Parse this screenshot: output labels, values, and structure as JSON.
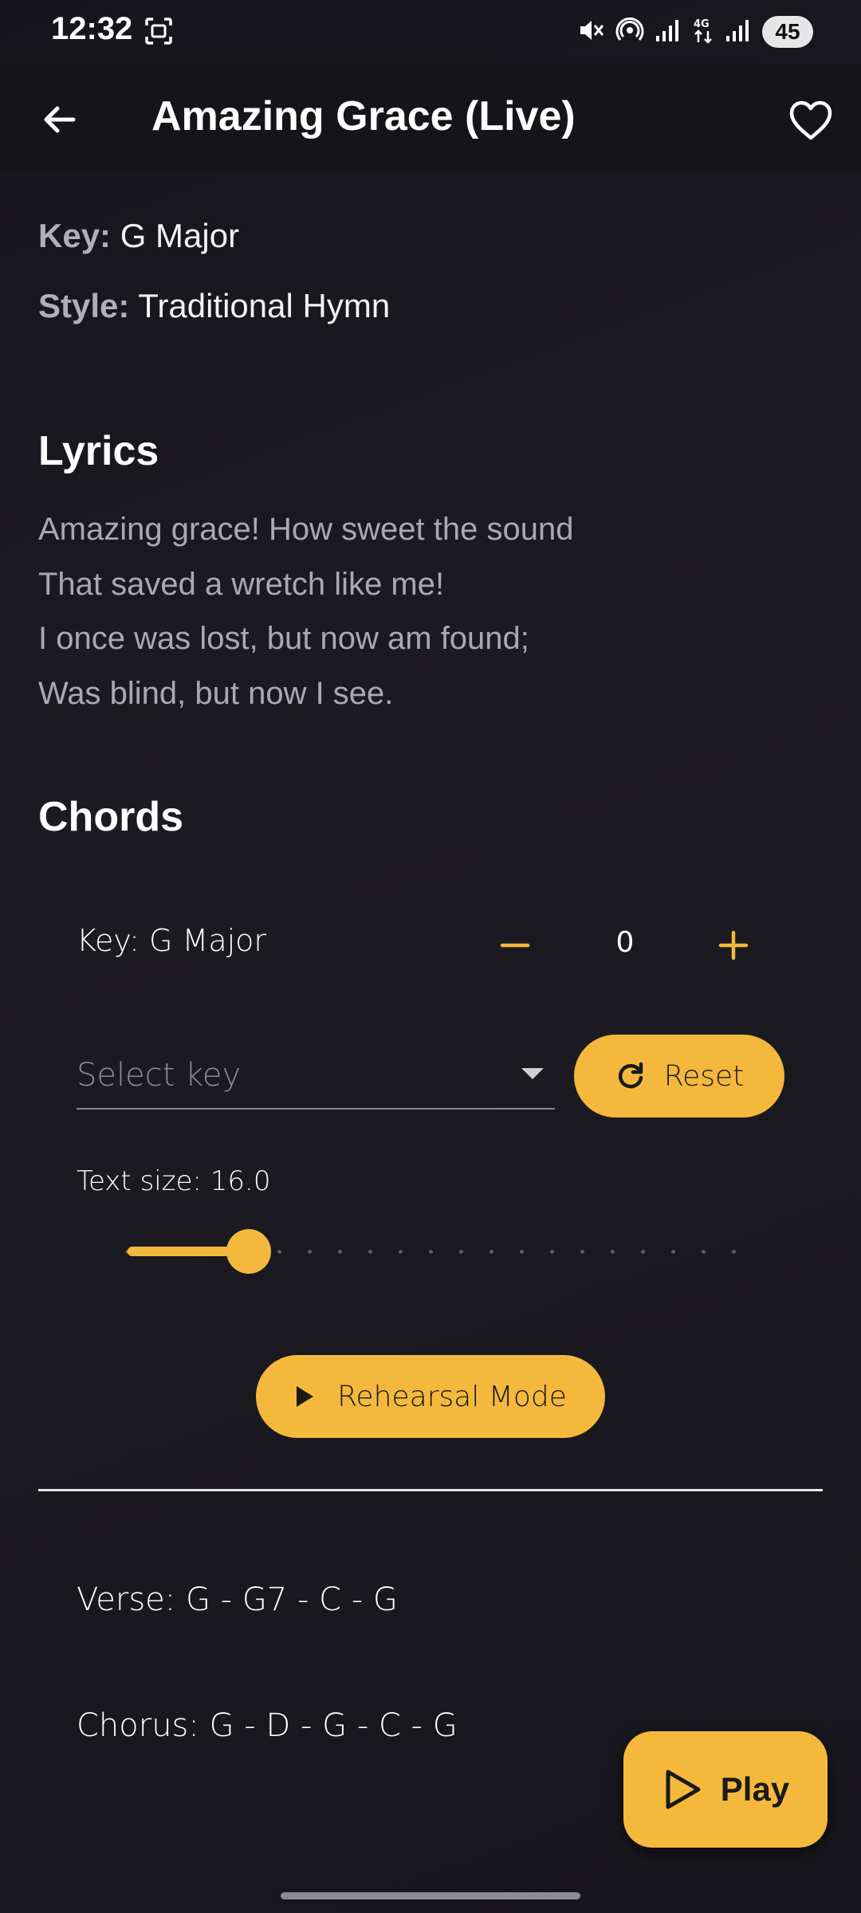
{
  "status_bar": {
    "time": "12:32",
    "battery": "45",
    "icons": [
      "screenshot-icon",
      "mute-icon",
      "hotspot-icon",
      "signal-icon",
      "4g-data-icon",
      "signal-icon"
    ]
  },
  "app_bar": {
    "title": "Amazing Grace (Live)",
    "back_icon": "back-arrow-icon",
    "favorite_icon": "heart-outline-icon"
  },
  "song_info": {
    "key_label": "Key:",
    "key_value": "G Major",
    "style_label": "Style:",
    "style_value": "Traditional Hymn"
  },
  "lyrics": {
    "title": "Lyrics",
    "lines": [
      "Amazing grace! How sweet the sound",
      "That saved a wretch like me!",
      "I once was lost, but now am found;",
      "Was blind, but now I see."
    ]
  },
  "chords": {
    "title": "Chords",
    "key_display": "Key: G Major",
    "transpose_value": "0",
    "select_placeholder": "Select key",
    "reset_label": "Reset",
    "text_size_label": "Text size: 16.0",
    "text_size_slider_fraction": 0.2,
    "rehearsal_label": "Rehearsal Mode",
    "verse": "Verse: G - G7 - C - G",
    "chorus": "Chorus: G - D - G - C - G"
  },
  "play_button": {
    "label": "Play"
  },
  "colors": {
    "accent": "#f4b93c",
    "background": "#17161c",
    "muted_text": "#aca7b4"
  }
}
